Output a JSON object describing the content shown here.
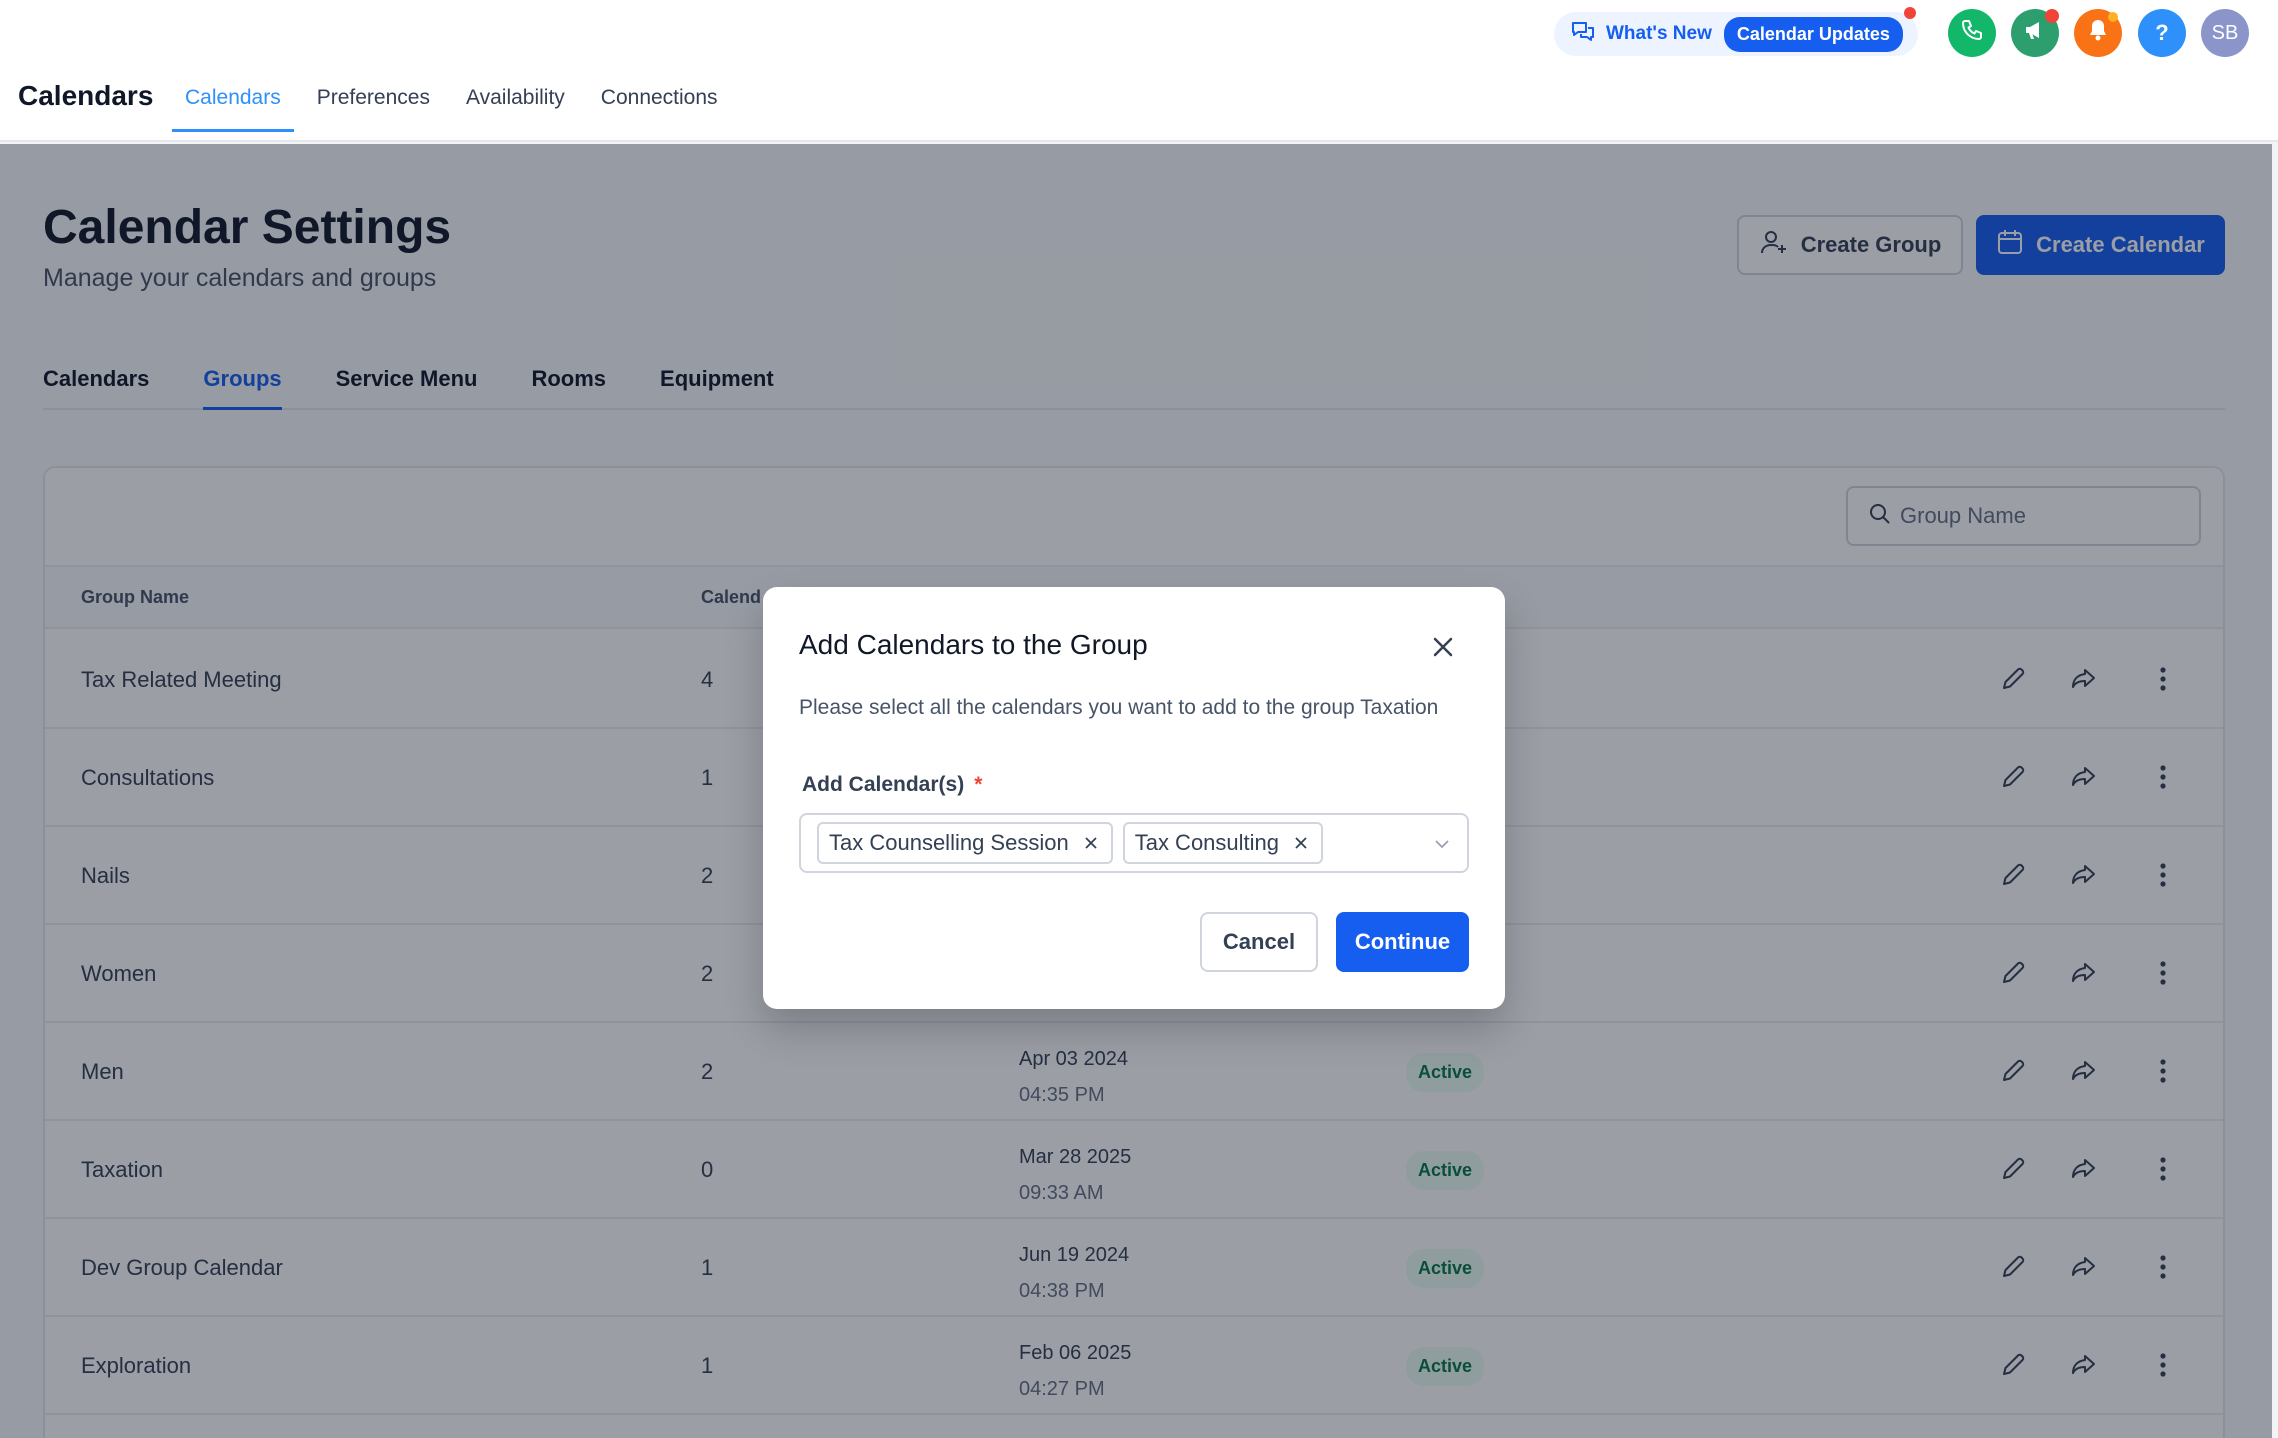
{
  "app": {
    "title": "Calendars"
  },
  "top_nav": [
    {
      "label": "Calendars",
      "active": true
    },
    {
      "label": "Preferences",
      "active": false
    },
    {
      "label": "Availability",
      "active": false
    },
    {
      "label": "Connections",
      "active": false
    }
  ],
  "header": {
    "whats_new": "What's New",
    "updates_pill": "Calendar Updates",
    "avatar_initials": "SB",
    "help_glyph": "?",
    "colors": {
      "phone": "#12b76a",
      "megaphone": "#2d9f6e",
      "bell": "#f97316",
      "help": "#2e90fa",
      "avatar": "#8b95c9"
    }
  },
  "page": {
    "title": "Calendar Settings",
    "subtitle": "Manage your calendars and groups",
    "create_group": "Create Group",
    "create_calendar": "Create Calendar"
  },
  "section_tabs": [
    {
      "label": "Calendars",
      "active": false
    },
    {
      "label": "Groups",
      "active": true
    },
    {
      "label": "Service Menu",
      "active": false
    },
    {
      "label": "Rooms",
      "active": false
    },
    {
      "label": "Equipment",
      "active": false
    }
  ],
  "search": {
    "placeholder": "Group Name"
  },
  "table": {
    "headers": {
      "name": "Group Name",
      "calendars": "Calend"
    },
    "rows": [
      {
        "name": "Tax Related Meeting",
        "count": "4",
        "date": "",
        "time": "",
        "status": ""
      },
      {
        "name": "Consultations",
        "count": "1",
        "date": "",
        "time": "",
        "status": ""
      },
      {
        "name": "Nails",
        "count": "2",
        "date": "",
        "time": "",
        "status": ""
      },
      {
        "name": "Women",
        "count": "2",
        "date": "",
        "time": "",
        "status": ""
      },
      {
        "name": "Men",
        "count": "2",
        "date": "Apr 03 2024",
        "time": "04:35 PM",
        "status": "Active"
      },
      {
        "name": "Taxation",
        "count": "0",
        "date": "Mar 28 2025",
        "time": "09:33 AM",
        "status": "Active"
      },
      {
        "name": "Dev Group Calendar",
        "count": "1",
        "date": "Jun 19 2024",
        "time": "04:38 PM",
        "status": "Active"
      },
      {
        "name": "Exploration",
        "count": "1",
        "date": "Feb 06 2025",
        "time": "04:27 PM",
        "status": "Active"
      }
    ]
  },
  "modal": {
    "title": "Add Calendars to the Group",
    "description": "Please select all the calendars you want to add to the group Taxation",
    "field_label": "Add Calendar(s)",
    "required_mark": "*",
    "selected": [
      "Tax Counselling Session",
      "Tax Consulting"
    ],
    "cancel": "Cancel",
    "continue": "Continue"
  }
}
